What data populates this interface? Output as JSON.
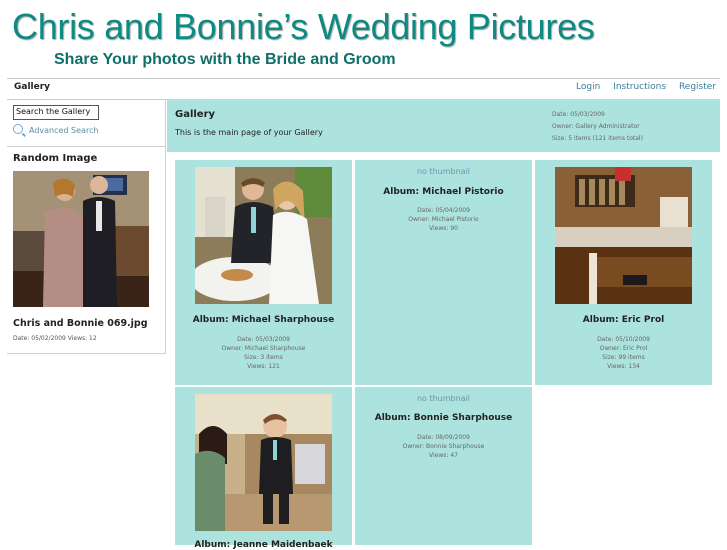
{
  "banner": {
    "title": "Chris and Bonnie’s Wedding Pictures",
    "subtitle": "Share Your photos with the Bride and Groom"
  },
  "nav": {
    "current": "Gallery",
    "links": [
      "Login",
      "Instructions",
      "Register"
    ]
  },
  "sidebar": {
    "search_value": "Search the Gallery",
    "advanced_search": "Advanced Search",
    "random_title": "Random Image",
    "random_caption": "Chris and Bonnie 069.jpg",
    "random_meta": "Date: 05/02/2009 Views: 12"
  },
  "gallery": {
    "title": "Gallery",
    "description": "This is the main page of your Gallery",
    "info": [
      "Date: 05/03/2009",
      "Owner: Gallery Administrator",
      "Size: 5 items (121 items total)"
    ]
  },
  "albums": [
    {
      "thumbnail": true,
      "title": "Album: Michael Sharphouse",
      "meta": [
        "Date: 05/03/2009",
        "Owner: Michael Sharphouse",
        "Size: 3 items",
        "Views: 121"
      ]
    },
    {
      "thumbnail": false,
      "no_thumb_label": "no thumbnail",
      "title": "Album: Michael Pistorio",
      "meta": [
        "Date: 05/04/2009",
        "Owner: Michael Pistorio",
        "Views: 90"
      ]
    },
    {
      "thumbnail": true,
      "title": "Album: Eric Prol",
      "meta": [
        "Date: 05/10/2009",
        "Owner: Eric Prol",
        "Size: 99 items",
        "Views: 134"
      ]
    },
    {
      "thumbnail": true,
      "title": "Album: Jeanne Maidenbaek",
      "meta": []
    },
    {
      "thumbnail": false,
      "no_thumb_label": "no thumbnail",
      "title": "Album: Bonnie Sharphouse",
      "meta": [
        "Date: 08/09/2009",
        "Owner: Bonnie Sharphouse",
        "Views: 47"
      ]
    }
  ]
}
